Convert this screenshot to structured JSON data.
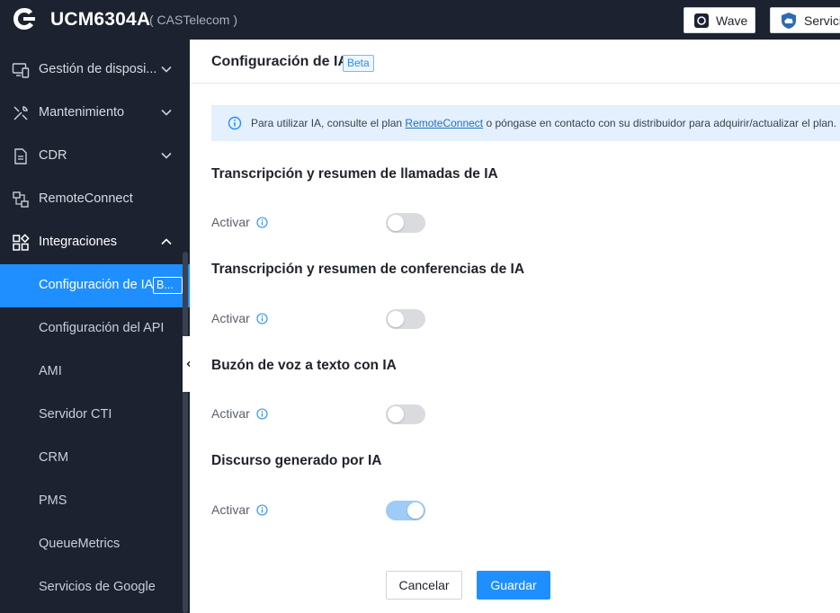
{
  "header": {
    "brand": "UCM6304A",
    "brand_sub": "( CASTelecom )",
    "wave_label": "Wave",
    "services_label": "Servicio"
  },
  "sidebar": {
    "items": [
      {
        "label": "Gestión de disposi...",
        "icon": "device-management-icon"
      },
      {
        "label": "Mantenimiento",
        "icon": "tools-icon"
      },
      {
        "label": "CDR",
        "icon": "document-icon"
      },
      {
        "label": "RemoteConnect",
        "icon": "remote-connect-icon"
      },
      {
        "label": "Integraciones",
        "icon": "integrations-icon"
      }
    ],
    "subitems": [
      {
        "label": "Configuración de IA",
        "badge": "B..."
      },
      {
        "label": "Configuración del API"
      },
      {
        "label": "AMI"
      },
      {
        "label": "Servidor CTI"
      },
      {
        "label": "CRM"
      },
      {
        "label": "PMS"
      },
      {
        "label": "QueueMetrics"
      },
      {
        "label": "Servicios de Google"
      }
    ]
  },
  "page": {
    "title": "Configuración de IA",
    "beta": "Beta",
    "info_before": "Para utilizar IA, consulte el plan ",
    "info_link": "RemoteConnect",
    "info_after": " o póngase en contacto con su distribuidor para adquirir/actualizar el plan.",
    "sections": [
      {
        "title": "Transcripción y resumen de llamadas de IA",
        "field_label": "Activar",
        "enabled": false
      },
      {
        "title": "Transcripción y resumen de conferencias de IA",
        "field_label": "Activar",
        "enabled": false
      },
      {
        "title": "Buzón de voz a texto con IA",
        "field_label": "Activar",
        "enabled": false
      },
      {
        "title": "Discurso generado por IA",
        "field_label": "Activar",
        "enabled": true
      }
    ],
    "cancel_label": "Cancelar",
    "save_label": "Guardar"
  },
  "colors": {
    "sidebar_bg": "#1c2230",
    "accent": "#1f8fff",
    "banner_bg": "#e4f0fd"
  }
}
